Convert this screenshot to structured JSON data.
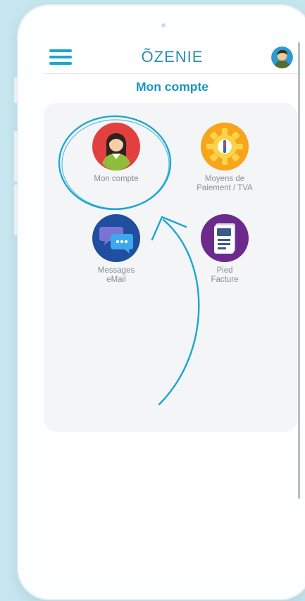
{
  "app": {
    "logo": "ÕZENIE",
    "page_title": "Mon compte"
  },
  "icons": {
    "menu": "hamburger-icon",
    "profile": "user-avatar-icon",
    "account": "woman-avatar-icon",
    "payment": "gear-icon",
    "messages": "chat-bubbles-icon",
    "invoice": "document-icon"
  },
  "tiles": [
    {
      "label": "Mon compte"
    },
    {
      "label": "Moyens de\nPaiement / TVA"
    },
    {
      "label": "Messages\neMail"
    },
    {
      "label": "Pied\nFacture"
    }
  ],
  "colors": {
    "accent": "#1aa6d1",
    "title": "#1b95bf",
    "background": "#c5e6ef"
  }
}
